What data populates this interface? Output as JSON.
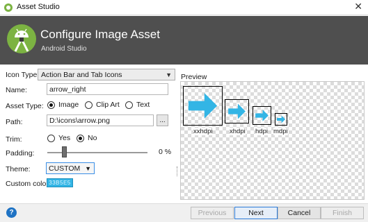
{
  "window": {
    "title": "Asset Studio",
    "close_glyph": "✕"
  },
  "header": {
    "title": "Configure Image Asset",
    "subtitle": "Android Studio"
  },
  "form": {
    "icon_type": {
      "label": "Icon Type:",
      "value": "Action Bar and Tab Icons"
    },
    "name": {
      "label": "Name:",
      "value": "arrow_right"
    },
    "asset_type": {
      "label": "Asset Type:",
      "options": [
        "Image",
        "Clip Art",
        "Text"
      ],
      "selected": "Image"
    },
    "path": {
      "label": "Path:",
      "value": "D:\\icons\\arrow.png",
      "browse_label": "..."
    },
    "trim": {
      "label": "Trim:",
      "options": [
        "Yes",
        "No"
      ],
      "selected": "No"
    },
    "padding": {
      "label": "Padding:",
      "value_text": "0 %",
      "value": 0
    },
    "theme": {
      "label": "Theme:",
      "value": "CUSTOM"
    },
    "custom_color": {
      "label": "Custom color:",
      "value": "33B5E5",
      "hex": "#33b5e5"
    }
  },
  "preview": {
    "label": "Preview",
    "densities": [
      "xxhdpi",
      "xhdpi",
      "hdpi",
      "mdpi"
    ],
    "icon_color": "#33b5e5"
  },
  "footer": {
    "help_label": "?",
    "previous_label": "Previous",
    "next_label": "Next",
    "cancel_label": "Cancel",
    "finish_label": "Finish"
  }
}
